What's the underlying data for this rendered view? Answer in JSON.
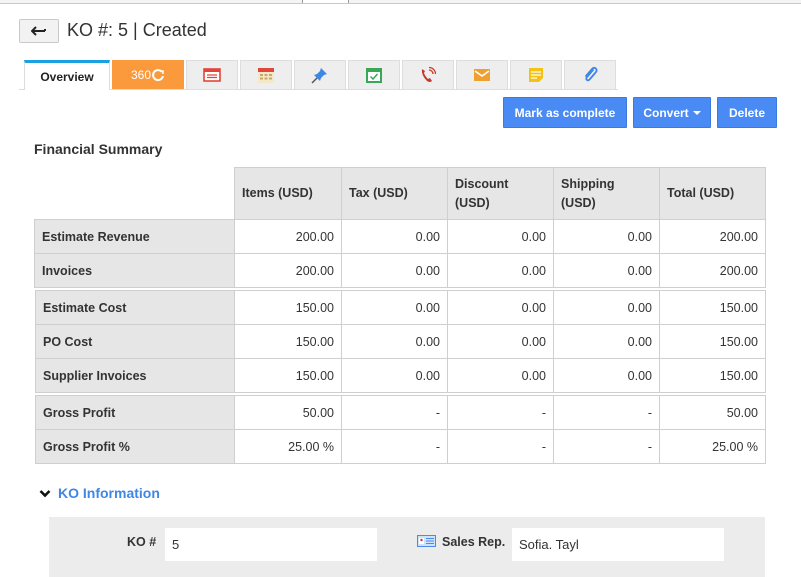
{
  "header": {
    "back_icon": "arrow-left-icon",
    "title": "KO #: 5 | Created"
  },
  "tabs": [
    {
      "label": "Overview",
      "active": true
    },
    {
      "label": "360",
      "icon": "refresh-360-icon",
      "color": "#fb9a3c"
    },
    {
      "icon": "invoice-icon",
      "color": "#e2463a"
    },
    {
      "icon": "calendar-icon",
      "color": "#e2463a"
    },
    {
      "icon": "pin-icon",
      "color": "#3f87e5"
    },
    {
      "icon": "calendar-check-icon",
      "color": "#3aa757"
    },
    {
      "icon": "phone-icon",
      "color": "#c8382c"
    },
    {
      "icon": "mail-icon",
      "color": "#f0a030"
    },
    {
      "icon": "note-icon",
      "color": "#f5c211"
    },
    {
      "icon": "paperclip-icon",
      "color": "#3f87e5"
    }
  ],
  "actions": {
    "mark_complete": "Mark as complete",
    "convert": "Convert",
    "delete": "Delete",
    "button_color": "#4a8af4"
  },
  "financial_summary": {
    "title": "Financial Summary",
    "columns": [
      "Items (USD)",
      "Tax (USD)",
      "Discount (USD)",
      "Shipping (USD)",
      "Total (USD)"
    ],
    "groups": [
      [
        {
          "label": "Estimate Revenue",
          "values": [
            "200.00",
            "0.00",
            "0.00",
            "0.00",
            "200.00"
          ]
        },
        {
          "label": "Invoices",
          "values": [
            "200.00",
            "0.00",
            "0.00",
            "0.00",
            "200.00"
          ]
        }
      ],
      [
        {
          "label": "Estimate Cost",
          "values": [
            "150.00",
            "0.00",
            "0.00",
            "0.00",
            "150.00"
          ]
        },
        {
          "label": "PO Cost",
          "values": [
            "150.00",
            "0.00",
            "0.00",
            "0.00",
            "150.00"
          ]
        },
        {
          "label": "Supplier Invoices",
          "values": [
            "150.00",
            "0.00",
            "0.00",
            "0.00",
            "150.00"
          ]
        }
      ],
      [
        {
          "label": "Gross Profit",
          "values": [
            "50.00",
            "-",
            "-",
            "-",
            "50.00"
          ]
        },
        {
          "label": "Gross Profit %",
          "values": [
            "25.00 %",
            "-",
            "-",
            "-",
            "25.00 %"
          ]
        }
      ]
    ]
  },
  "ko_information": {
    "title": "KO Information",
    "expanded": true,
    "ko_number_label": "KO #",
    "ko_number_value": "5",
    "sales_rep_label": "Sales Rep.",
    "sales_rep_value": "Sofia. Tayl"
  }
}
